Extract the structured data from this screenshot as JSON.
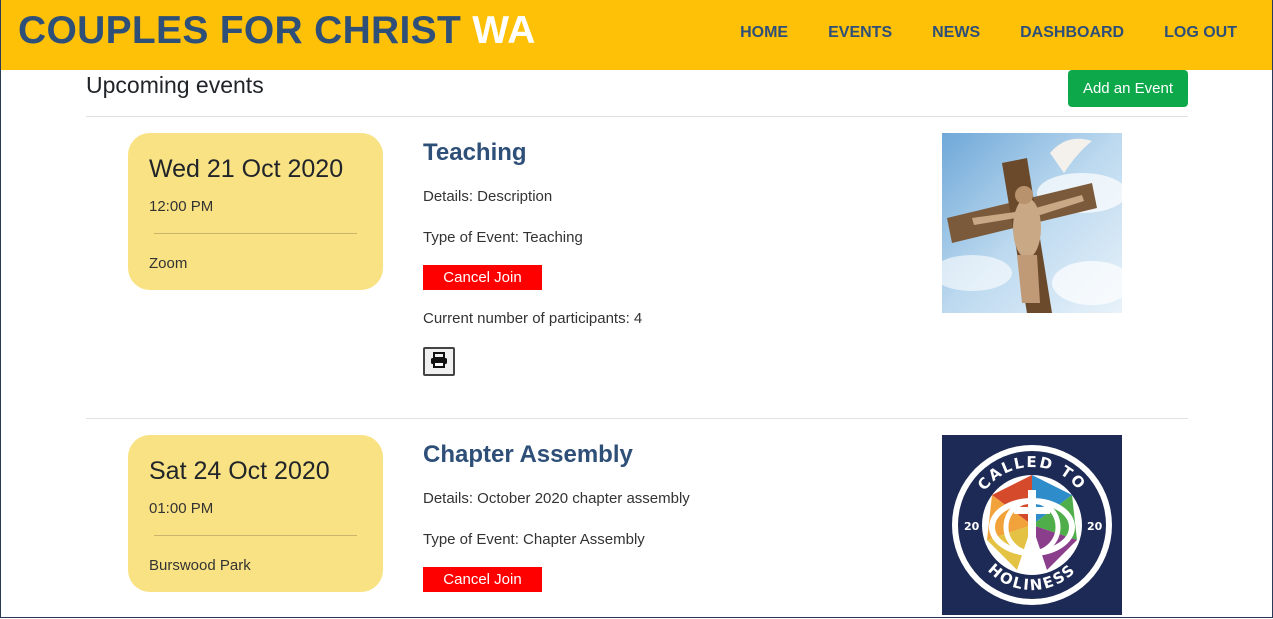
{
  "brand": {
    "main": "COUPLES FOR CHRIST",
    "accent": "WA"
  },
  "nav": {
    "items": [
      "HOME",
      "EVENTS",
      "NEWS",
      "DASHBOARD",
      "LOG OUT"
    ]
  },
  "page": {
    "title": "Upcoming events",
    "add_button": "Add an Event"
  },
  "events": [
    {
      "date": "Wed 21 Oct 2020",
      "time": "12:00 PM",
      "location": "Zoom",
      "title": "Teaching",
      "details": "Details: Description",
      "type": "Type of Event: Teaching",
      "action": "Cancel Join",
      "participants": "Current number of participants: 4",
      "image": "crucifix-dove-image"
    },
    {
      "date": "Sat 24 Oct 2020",
      "time": "01:00 PM",
      "location": "Burswood Park",
      "title": "Chapter Assembly",
      "details": "Details: October 2020 chapter assembly",
      "type": "Type of Event: Chapter Assembly",
      "action": "Cancel Join",
      "image": "called-to-holiness-logo-image",
      "logo_text": {
        "top": "CALLED TO",
        "bottom": "HOLINESS",
        "left": "20",
        "right": "20"
      }
    }
  ],
  "colors": {
    "header": "#ffc107",
    "brand_text": "#2e4f78",
    "date_card": "#f9e283",
    "add_button": "#0da84a",
    "cancel_button": "#ff0000"
  }
}
